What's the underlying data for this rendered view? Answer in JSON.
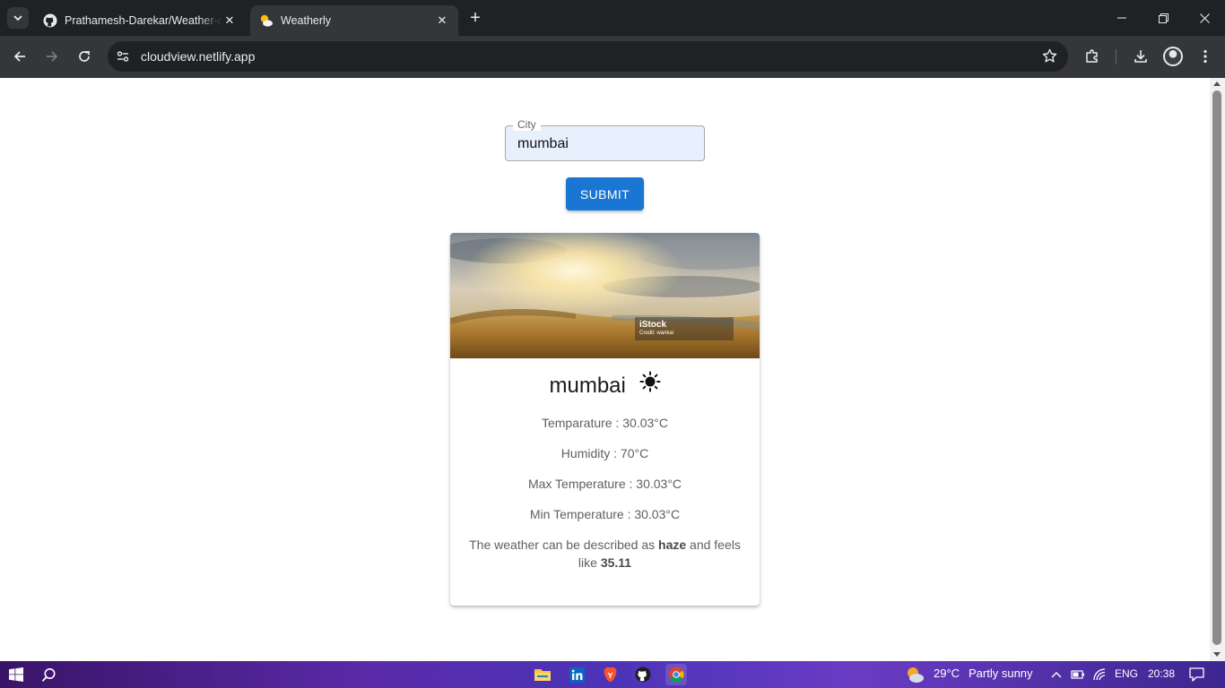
{
  "browser": {
    "tabs": [
      {
        "title": "Prathamesh-Darekar/Weather-app",
        "icon": "github-icon",
        "active": false
      },
      {
        "title": "Weatherly",
        "icon": "weather-icon",
        "active": true
      }
    ],
    "url": "cloudview.netlify.app"
  },
  "form": {
    "city_label": "City",
    "city_value": "mumbai",
    "submit_label": "SUBMIT"
  },
  "card": {
    "image_watermark": "iStock",
    "image_credit": "Credit: wankai",
    "city": "mumbai",
    "condition_icon": "sun-icon",
    "temperature": "Temparature : 30.03°C",
    "humidity": "Humidity : 70°C",
    "max_temperature": "Max Temperature : 30.03°C",
    "min_temperature": "Min Temperature : 30.03°C",
    "description_prefix": "The weather can be described as",
    "description_condition": "haze",
    "description_middle": "and feels like",
    "description_feels_like": "35.11"
  },
  "taskbar": {
    "weather": "29°C",
    "weather_text": "Partly sunny",
    "language": "ENG",
    "time": "20:38"
  },
  "colors": {
    "submit_button": "#1976d2",
    "input_autofill_bg": "#e8f0fe"
  }
}
